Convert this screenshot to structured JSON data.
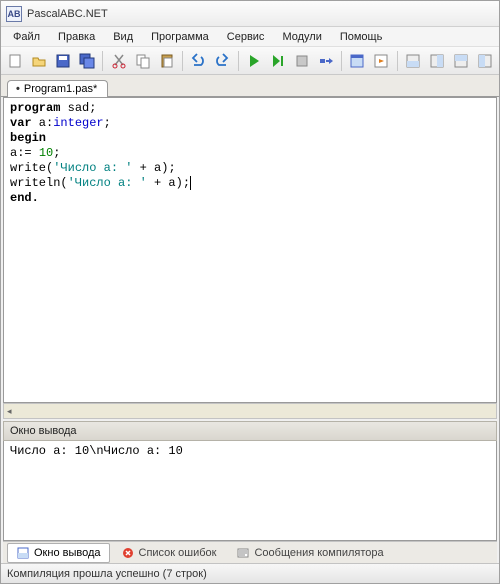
{
  "window": {
    "title": "PascalABC.NET"
  },
  "menus": {
    "file": "Файл",
    "edit": "Правка",
    "view": "Вид",
    "program": "Программа",
    "service": "Сервис",
    "modules": "Модули",
    "help": "Помощь"
  },
  "tab": {
    "dirty_marker": "•",
    "filename": "Program1.pas*"
  },
  "code": {
    "l1a": "program",
    "l1b": " sad;",
    "l2a": "var",
    "l2b": " a:",
    "l2c": "integer",
    "l2d": ";",
    "l3": "begin",
    "l4a": "a:= ",
    "l4b": "10",
    "l4c": ";",
    "l5a": "write(",
    "l5b": "'Число a: '",
    "l5c": " + a);",
    "l6a": "writeln(",
    "l6b": "'Число a: '",
    "l6c": " + a);",
    "l7": "end."
  },
  "output": {
    "header": "Окно вывода",
    "text": "Число a: 10\\nЧисло a: 10"
  },
  "bottom_tabs": {
    "output": "Окно вывода",
    "errors": "Список ошибок",
    "compiler": "Сообщения компилятора"
  },
  "status": {
    "text": "Компиляция прошла успешно (7 строк)"
  }
}
